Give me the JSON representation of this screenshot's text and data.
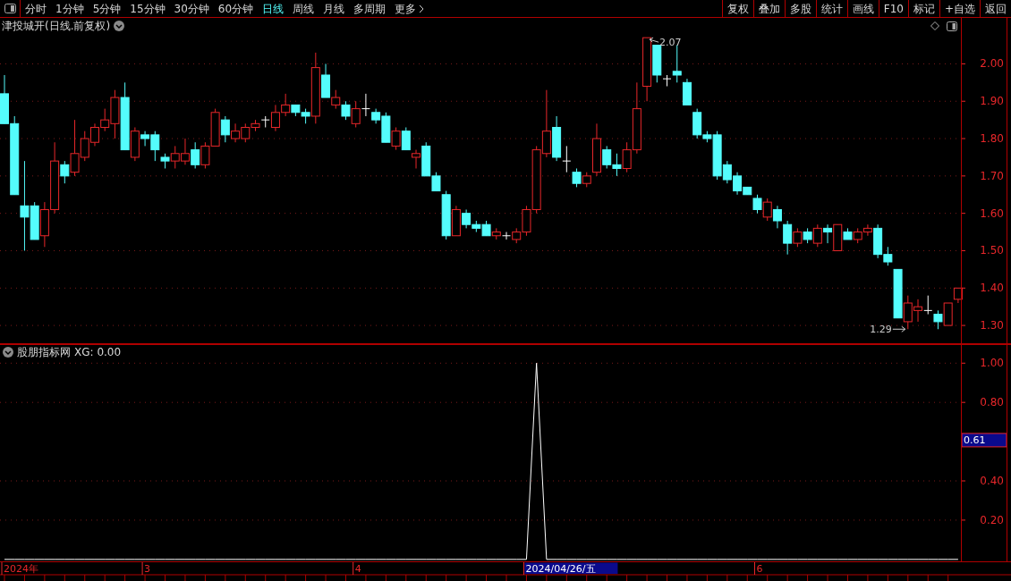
{
  "toolbar": {
    "periods": [
      {
        "label": "分时",
        "selected": false
      },
      {
        "label": "1分钟",
        "selected": false
      },
      {
        "label": "5分钟",
        "selected": false
      },
      {
        "label": "15分钟",
        "selected": false
      },
      {
        "label": "30分钟",
        "selected": false
      },
      {
        "label": "60分钟",
        "selected": false
      },
      {
        "label": "日线",
        "selected": true
      },
      {
        "label": "周线",
        "selected": false
      },
      {
        "label": "月线",
        "selected": false
      },
      {
        "label": "多周期",
        "selected": false
      },
      {
        "label": "更多",
        "selected": false
      }
    ],
    "actions": [
      "复权",
      "叠加",
      "多股",
      "统计",
      "画线",
      "F10",
      "标记",
      "+自选",
      "返回"
    ]
  },
  "price_panel": {
    "title": "津投城开(日线.前复权)",
    "chart_data": {
      "type": "candlestick",
      "grid": true,
      "ylim": [
        1.25,
        2.123
      ],
      "yticks": [
        {
          "value": 1.3,
          "label": "1.30"
        },
        {
          "value": 1.4,
          "label": "1.40"
        },
        {
          "value": 1.5,
          "label": "1.50"
        },
        {
          "value": 1.6,
          "label": "1.60"
        },
        {
          "value": 1.7,
          "label": "1.70"
        },
        {
          "value": 1.8,
          "label": "1.80"
        },
        {
          "value": 1.9,
          "label": "1.90"
        },
        {
          "value": 2.0,
          "label": "2.00"
        }
      ],
      "ohlc": [
        [
          1.92,
          1.97,
          1.84,
          1.84
        ],
        [
          1.84,
          1.86,
          1.65,
          1.65
        ],
        [
          1.62,
          1.74,
          1.5,
          1.59
        ],
        [
          1.62,
          1.63,
          1.53,
          1.53
        ],
        [
          1.54,
          1.63,
          1.51,
          1.61
        ],
        [
          1.61,
          1.79,
          1.6,
          1.74
        ],
        [
          1.73,
          1.74,
          1.68,
          1.7
        ],
        [
          1.71,
          1.85,
          1.7,
          1.76
        ],
        [
          1.75,
          1.82,
          1.74,
          1.8
        ],
        [
          1.79,
          1.84,
          1.78,
          1.83
        ],
        [
          1.83,
          1.88,
          1.82,
          1.85
        ],
        [
          1.84,
          1.93,
          1.8,
          1.91
        ],
        [
          1.91,
          1.95,
          1.77,
          1.77
        ],
        [
          1.75,
          1.83,
          1.74,
          1.82
        ],
        [
          1.81,
          1.82,
          1.78,
          1.8
        ],
        [
          1.81,
          1.82,
          1.74,
          1.77
        ],
        [
          1.75,
          1.76,
          1.72,
          1.74
        ],
        [
          1.74,
          1.78,
          1.72,
          1.76
        ],
        [
          1.74,
          1.8,
          1.73,
          1.76
        ],
        [
          1.77,
          1.79,
          1.72,
          1.73
        ],
        [
          1.73,
          1.79,
          1.72,
          1.78
        ],
        [
          1.78,
          1.88,
          1.78,
          1.87
        ],
        [
          1.85,
          1.86,
          1.79,
          1.81
        ],
        [
          1.8,
          1.84,
          1.79,
          1.82
        ],
        [
          1.8,
          1.84,
          1.79,
          1.83
        ],
        [
          1.83,
          1.85,
          1.82,
          1.84
        ],
        [
          1.85,
          1.86,
          1.83,
          1.85
        ],
        [
          1.83,
          1.89,
          1.82,
          1.87
        ],
        [
          1.87,
          1.92,
          1.86,
          1.89
        ],
        [
          1.89,
          1.89,
          1.86,
          1.87
        ],
        [
          1.87,
          1.88,
          1.84,
          1.86
        ],
        [
          1.86,
          2.03,
          1.84,
          1.99
        ],
        [
          1.97,
          2.0,
          1.91,
          1.91
        ],
        [
          1.89,
          1.93,
          1.88,
          1.91
        ],
        [
          1.89,
          1.9,
          1.85,
          1.86
        ],
        [
          1.84,
          1.9,
          1.83,
          1.88
        ],
        [
          1.88,
          1.92,
          1.86,
          1.88
        ],
        [
          1.87,
          1.88,
          1.84,
          1.85
        ],
        [
          1.86,
          1.87,
          1.79,
          1.79
        ],
        [
          1.78,
          1.83,
          1.77,
          1.82
        ],
        [
          1.82,
          1.83,
          1.77,
          1.77
        ],
        [
          1.75,
          1.77,
          1.72,
          1.76
        ],
        [
          1.78,
          1.79,
          1.7,
          1.7
        ],
        [
          1.7,
          1.71,
          1.66,
          1.66
        ],
        [
          1.65,
          1.66,
          1.53,
          1.54
        ],
        [
          1.54,
          1.62,
          1.54,
          1.61
        ],
        [
          1.6,
          1.61,
          1.56,
          1.57
        ],
        [
          1.57,
          1.58,
          1.55,
          1.56
        ],
        [
          1.57,
          1.58,
          1.54,
          1.54
        ],
        [
          1.54,
          1.56,
          1.53,
          1.55
        ],
        [
          1.54,
          1.55,
          1.53,
          1.54
        ],
        [
          1.53,
          1.56,
          1.52,
          1.55
        ],
        [
          1.55,
          1.62,
          1.54,
          1.61
        ],
        [
          1.61,
          1.78,
          1.6,
          1.77
        ],
        [
          1.76,
          1.93,
          1.75,
          1.82
        ],
        [
          1.83,
          1.86,
          1.74,
          1.75
        ],
        [
          1.74,
          1.78,
          1.71,
          1.74
        ],
        [
          1.71,
          1.72,
          1.67,
          1.68
        ],
        [
          1.68,
          1.71,
          1.67,
          1.7
        ],
        [
          1.71,
          1.84,
          1.7,
          1.8
        ],
        [
          1.77,
          1.78,
          1.72,
          1.73
        ],
        [
          1.73,
          1.76,
          1.7,
          1.72
        ],
        [
          1.72,
          1.79,
          1.71,
          1.77
        ],
        [
          1.77,
          1.95,
          1.76,
          1.88
        ],
        [
          1.94,
          2.07,
          1.9,
          2.07
        ],
        [
          2.05,
          2.05,
          1.95,
          1.97
        ],
        [
          1.96,
          1.97,
          1.94,
          1.96
        ],
        [
          1.98,
          2.05,
          1.95,
          1.97
        ],
        [
          1.95,
          1.96,
          1.89,
          1.89
        ],
        [
          1.87,
          1.88,
          1.8,
          1.81
        ],
        [
          1.81,
          1.82,
          1.79,
          1.8
        ],
        [
          1.81,
          1.82,
          1.69,
          1.7
        ],
        [
          1.73,
          1.74,
          1.68,
          1.69
        ],
        [
          1.7,
          1.71,
          1.65,
          1.66
        ],
        [
          1.67,
          1.67,
          1.65,
          1.65
        ],
        [
          1.64,
          1.65,
          1.6,
          1.61
        ],
        [
          1.59,
          1.64,
          1.58,
          1.63
        ],
        [
          1.61,
          1.62,
          1.56,
          1.58
        ],
        [
          1.57,
          1.58,
          1.49,
          1.52
        ],
        [
          1.52,
          1.56,
          1.51,
          1.55
        ],
        [
          1.55,
          1.56,
          1.52,
          1.53
        ],
        [
          1.52,
          1.57,
          1.51,
          1.56
        ],
        [
          1.56,
          1.57,
          1.52,
          1.55
        ],
        [
          1.5,
          1.57,
          1.5,
          1.57
        ],
        [
          1.55,
          1.56,
          1.53,
          1.53
        ],
        [
          1.53,
          1.56,
          1.52,
          1.55
        ],
        [
          1.55,
          1.57,
          1.54,
          1.56
        ],
        [
          1.56,
          1.57,
          1.48,
          1.49
        ],
        [
          1.49,
          1.51,
          1.46,
          1.47
        ],
        [
          1.45,
          1.45,
          1.32,
          1.32
        ],
        [
          1.31,
          1.38,
          1.29,
          1.36
        ],
        [
          1.34,
          1.37,
          1.31,
          1.35
        ],
        [
          1.34,
          1.38,
          1.33,
          1.34
        ],
        [
          1.33,
          1.34,
          1.29,
          1.31
        ],
        [
          1.3,
          1.36,
          1.3,
          1.36
        ],
        [
          1.37,
          1.4,
          1.36,
          1.4
        ]
      ],
      "annotations": [
        "2.07",
        "1.29"
      ]
    }
  },
  "indicator_panel": {
    "title": "股朋指标网",
    "readout": "XG: 0.00",
    "value_tag": "0.61",
    "chart_data": {
      "type": "line",
      "grid": true,
      "ylim": [
        -0.01,
        1.097
      ],
      "yticks": [
        {
          "value": 0.2,
          "label": "0.20"
        },
        {
          "value": 0.4,
          "label": "0.40"
        },
        {
          "value": 0.8,
          "label": "0.80"
        },
        {
          "value": 1.0,
          "label": "1.00"
        }
      ],
      "series": [
        {
          "color": "#ffffff",
          "values": [
            0,
            0,
            0,
            0,
            0,
            0,
            0,
            0,
            0,
            0,
            0,
            0,
            0,
            0,
            0,
            0,
            0,
            0,
            0,
            0,
            0,
            0,
            0,
            0,
            0,
            0,
            0,
            0,
            0,
            0,
            0,
            0,
            0,
            0,
            0,
            0,
            0,
            0,
            0,
            0,
            0,
            0,
            0,
            0,
            0,
            0,
            0,
            0,
            0,
            0,
            0,
            0,
            0,
            1,
            0,
            0,
            0,
            0,
            0,
            0,
            0,
            0,
            0,
            0,
            0,
            0,
            0,
            0,
            0,
            0,
            0,
            0,
            0,
            0,
            0,
            0,
            0,
            0,
            0,
            0,
            0,
            0,
            0,
            0,
            0,
            0,
            0,
            0,
            0,
            0,
            0,
            0,
            0,
            0,
            0,
            0
          ]
        }
      ]
    }
  },
  "time_axis": [
    {
      "label": "2024年",
      "selected": false
    },
    {
      "label": "3",
      "selected": false
    },
    {
      "label": "4",
      "selected": false
    },
    {
      "label": "2024/04/26/五",
      "selected": true
    },
    {
      "label": "6",
      "selected": false
    }
  ]
}
